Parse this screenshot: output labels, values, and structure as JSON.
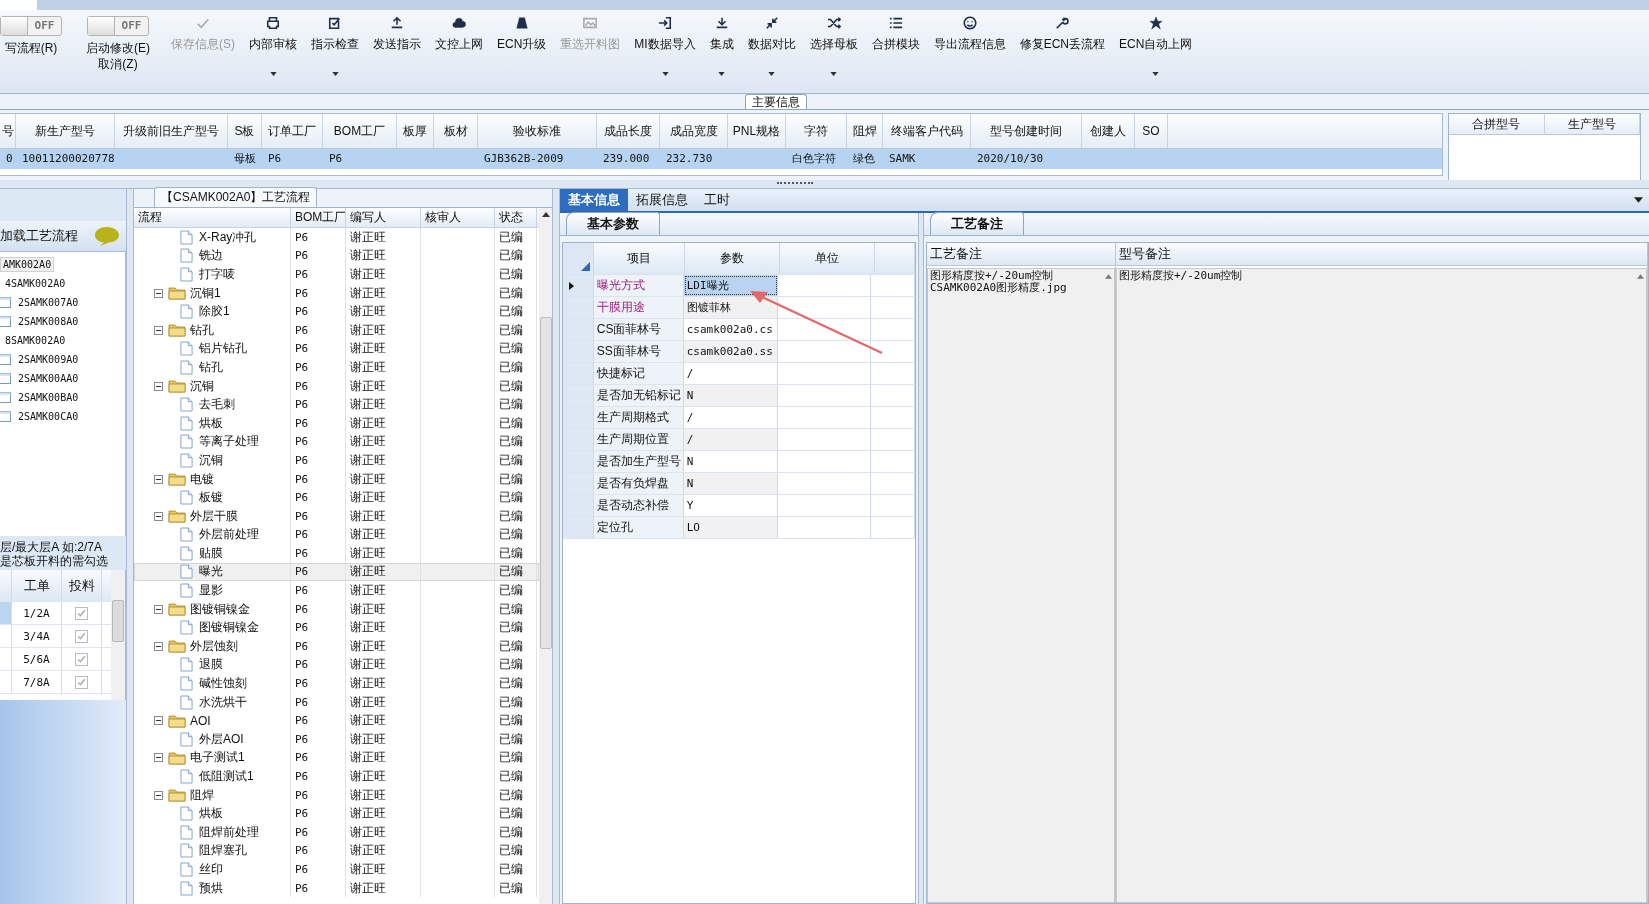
{
  "toolbar": {
    "toggles": [
      {
        "state_text": "OFF",
        "on": false,
        "labels": [
          "写流程(R)"
        ]
      },
      {
        "state_text": "OFF",
        "on": false,
        "labels": [
          "启动修改(E)",
          "取消(Z)"
        ]
      }
    ],
    "buttons": [
      {
        "label": "保存信息(S)",
        "disabled": true,
        "dropdown": false
      },
      {
        "label": "内部审核",
        "disabled": false,
        "dropdown": true
      },
      {
        "label": "指示检查",
        "disabled": false,
        "dropdown": true
      },
      {
        "label": "发送指示",
        "disabled": false,
        "dropdown": false
      },
      {
        "label": "文控上网",
        "disabled": false,
        "dropdown": false
      },
      {
        "label": "ECN升级",
        "disabled": false,
        "dropdown": false
      },
      {
        "label": "重选开料图",
        "disabled": true,
        "dropdown": false
      },
      {
        "label": "MI数据导入",
        "disabled": false,
        "dropdown": true
      },
      {
        "label": "集成",
        "disabled": false,
        "dropdown": true
      },
      {
        "label": "数据对比",
        "disabled": false,
        "dropdown": true
      },
      {
        "label": "选择母板",
        "disabled": false,
        "dropdown": true
      },
      {
        "label": "合拼模块",
        "disabled": false,
        "dropdown": false
      },
      {
        "label": "导出流程信息",
        "disabled": false,
        "dropdown": false
      },
      {
        "label": "修复ECN丢流程",
        "disabled": false,
        "dropdown": false
      },
      {
        "label": "ECN自动上网",
        "disabled": false,
        "dropdown": true
      }
    ]
  },
  "main_info": {
    "caption": "主要信息",
    "columns": [
      "号",
      "新生产型号",
      "升级前旧生产型号",
      "S板",
      "订单工厂",
      "BOM工厂",
      "板厚",
      "板材",
      "验收标准",
      "成品长度",
      "成品宽度",
      "PNL规格",
      "字符",
      "阻焊",
      "终端客户代码",
      "型号创建时间",
      "创建人",
      "SO"
    ],
    "rows": [
      {
        "selected": true,
        "cells": [
          "0",
          "10011200020778",
          null,
          "母板",
          "P6",
          "P6",
          null,
          null,
          "GJB362B-2009",
          "239.000",
          "232.730",
          null,
          "白色字符",
          "绿色",
          "SAMK",
          "2020/10/30",
          null,
          null
        ]
      }
    ]
  },
  "merge_table": {
    "columns": [
      "合拼型号",
      "生产型号"
    ]
  },
  "left_panel": {
    "header": "加载工艺流程",
    "items": [
      {
        "label": "AMK002A0",
        "selected": true,
        "children": [
          {
            "label": "4SAMK002A0",
            "selected": false,
            "children": [
              {
                "label": "2SAMK007A0",
                "selected": false
              },
              {
                "label": "2SAMK008A0",
                "selected": false
              }
            ]
          },
          {
            "label": "8SAMK002A0",
            "selected": false,
            "children": [
              {
                "label": "2SAMK009A0",
                "selected": false
              },
              {
                "label": "2SAMK00AA0",
                "selected": false
              },
              {
                "label": "2SAMK00BA0",
                "selected": false
              },
              {
                "label": "2SAMK00CA0",
                "selected": false
              }
            ]
          }
        ]
      }
    ],
    "notes": [
      "层/最大层A 如:2/7A",
      "是芯板开料的需勾选"
    ],
    "grid": {
      "columns": [
        "工单",
        "投料"
      ],
      "rows": [
        {
          "order": "1/2A",
          "checked": true,
          "disabled": true,
          "selected": true
        },
        {
          "order": "3/4A",
          "checked": true,
          "disabled": true,
          "selected": false
        },
        {
          "order": "5/6A",
          "checked": true,
          "disabled": true,
          "selected": false
        },
        {
          "order": "7/8A",
          "checked": true,
          "disabled": true,
          "selected": false
        }
      ]
    }
  },
  "process_tree": {
    "title": "【CSAMK002A0】工艺流程",
    "columns": [
      "流程",
      "BOM工厂",
      "编写人",
      "核审人",
      "状态"
    ],
    "rows": [
      {
        "kind": "step",
        "name": "X-Ray冲孔",
        "bom": "P6",
        "writer": "谢正旺",
        "status": "已编",
        "selected": false
      },
      {
        "kind": "step",
        "name": "铣边",
        "bom": "P6",
        "writer": "谢正旺",
        "status": "已编",
        "selected": false
      },
      {
        "kind": "step",
        "name": "打字唛",
        "bom": "P6",
        "writer": "谢正旺",
        "status": "已编",
        "selected": false
      },
      {
        "kind": "group",
        "name": "沉铜1",
        "bom": "P6",
        "writer": "谢正旺",
        "status": "已编",
        "selected": false,
        "expanded": true,
        "children": [
          {
            "kind": "step",
            "name": "除胶1",
            "bom": "P6",
            "writer": "谢正旺",
            "status": "已编",
            "selected": false
          }
        ]
      },
      {
        "kind": "group",
        "name": "钻孔",
        "bom": "P6",
        "writer": "谢正旺",
        "status": "已编",
        "selected": false,
        "expanded": true,
        "children": [
          {
            "kind": "step",
            "name": "铝片钻孔",
            "bom": "P6",
            "writer": "谢正旺",
            "status": "已编",
            "selected": false
          },
          {
            "kind": "step",
            "name": "钻孔",
            "bom": "P6",
            "writer": "谢正旺",
            "status": "已编",
            "selected": false
          }
        ]
      },
      {
        "kind": "group",
        "name": "沉铜",
        "bom": "P6",
        "writer": "谢正旺",
        "status": "已编",
        "selected": false,
        "expanded": true,
        "children": [
          {
            "kind": "step",
            "name": "去毛刺",
            "bom": "P6",
            "writer": "谢正旺",
            "status": "已编",
            "selected": false
          },
          {
            "kind": "step",
            "name": "烘板",
            "bom": "P6",
            "writer": "谢正旺",
            "status": "已编",
            "selected": false
          },
          {
            "kind": "step",
            "name": "等离子处理",
            "bom": "P6",
            "writer": "谢正旺",
            "status": "已编",
            "selected": false
          },
          {
            "kind": "step",
            "name": "沉铜",
            "bom": "P6",
            "writer": "谢正旺",
            "status": "已编",
            "selected": false
          }
        ]
      },
      {
        "kind": "group",
        "name": "电镀",
        "bom": "P6",
        "writer": "谢正旺",
        "status": "已编",
        "selected": false,
        "expanded": true,
        "children": [
          {
            "kind": "step",
            "name": "板镀",
            "bom": "P6",
            "writer": "谢正旺",
            "status": "已编",
            "selected": false
          }
        ]
      },
      {
        "kind": "group",
        "name": "外层干膜",
        "bom": "P6",
        "writer": "谢正旺",
        "status": "已编",
        "selected": false,
        "expanded": true,
        "children": [
          {
            "kind": "step",
            "name": "外层前处理",
            "bom": "P6",
            "writer": "谢正旺",
            "status": "已编",
            "selected": false
          },
          {
            "kind": "step",
            "name": "贴膜",
            "bom": "P6",
            "writer": "谢正旺",
            "status": "已编",
            "selected": false
          },
          {
            "kind": "step",
            "name": "曝光",
            "bom": "P6",
            "writer": "谢正旺",
            "status": "已编",
            "selected": true
          },
          {
            "kind": "step",
            "name": "显影",
            "bom": "P6",
            "writer": "谢正旺",
            "status": "已编",
            "selected": false
          }
        ]
      },
      {
        "kind": "group",
        "name": "图镀铜镍金",
        "bom": "P6",
        "writer": "谢正旺",
        "status": "已编",
        "selected": false,
        "expanded": true,
        "children": [
          {
            "kind": "step",
            "name": "图镀铜镍金",
            "bom": "P6",
            "writer": "谢正旺",
            "status": "已编",
            "selected": false
          }
        ]
      },
      {
        "kind": "group",
        "name": "外层蚀刻",
        "bom": "P6",
        "writer": "谢正旺",
        "status": "已编",
        "selected": false,
        "expanded": true,
        "children": [
          {
            "kind": "step",
            "name": "退膜",
            "bom": "P6",
            "writer": "谢正旺",
            "status": "已编",
            "selected": false
          },
          {
            "kind": "step",
            "name": "碱性蚀刻",
            "bom": "P6",
            "writer": "谢正旺",
            "status": "已编",
            "selected": false
          },
          {
            "kind": "step",
            "name": "水洗烘干",
            "bom": "P6",
            "writer": "谢正旺",
            "status": "已编",
            "selected": false
          }
        ]
      },
      {
        "kind": "group",
        "name": "AOI",
        "bom": "P6",
        "writer": "谢正旺",
        "status": "已编",
        "selected": false,
        "expanded": true,
        "children": [
          {
            "kind": "step",
            "name": "外层AOI",
            "bom": "P6",
            "writer": "谢正旺",
            "status": "已编",
            "selected": false
          }
        ]
      },
      {
        "kind": "group",
        "name": "电子测试1",
        "bom": "P6",
        "writer": "谢正旺",
        "status": "已编",
        "selected": false,
        "expanded": true,
        "children": [
          {
            "kind": "step",
            "name": "低阻测试1",
            "bom": "P6",
            "writer": "谢正旺",
            "status": "已编",
            "selected": false
          }
        ]
      },
      {
        "kind": "group",
        "name": "阻焊",
        "bom": "P6",
        "writer": "谢正旺",
        "status": "已编",
        "selected": false,
        "expanded": true,
        "children": [
          {
            "kind": "step",
            "name": "烘板",
            "bom": "P6",
            "writer": "谢正旺",
            "status": "已编",
            "selected": false
          },
          {
            "kind": "step",
            "name": "阻焊前处理",
            "bom": "P6",
            "writer": "谢正旺",
            "status": "已编",
            "selected": false
          },
          {
            "kind": "step",
            "name": "阻焊塞孔",
            "bom": "P6",
            "writer": "谢正旺",
            "status": "已编",
            "selected": false
          },
          {
            "kind": "step",
            "name": "丝印",
            "bom": "P6",
            "writer": "谢正旺",
            "status": "已编",
            "selected": false
          },
          {
            "kind": "step",
            "name": "预烘",
            "bom": "P6",
            "writer": "谢正旺",
            "status": "已编",
            "selected": false
          }
        ]
      }
    ]
  },
  "detail_tabs": [
    {
      "label": "基本信息",
      "selected": true
    },
    {
      "label": "拓展信息",
      "selected": false
    },
    {
      "label": "工时",
      "selected": false
    }
  ],
  "basic_params": {
    "tab": "基本参数",
    "columns": [
      "项目",
      "参数",
      "单位"
    ],
    "rows": [
      {
        "name": "曝光方式",
        "value": "LDI曝光",
        "required": true,
        "selected": true
      },
      {
        "name": "干膜用途",
        "value": "图镀菲林",
        "required": true,
        "selected": false
      },
      {
        "name": "CS面菲林号",
        "value": "csamk002a0.cs",
        "required": false,
        "selected": false
      },
      {
        "name": "SS面菲林号",
        "value": "csamk002a0.ss",
        "required": false,
        "selected": false
      },
      {
        "name": "快捷标记",
        "value": "/",
        "required": false,
        "selected": false
      },
      {
        "name": "是否加无铅标记",
        "value": "N",
        "required": false,
        "selected": false
      },
      {
        "name": "生产周期格式",
        "value": "/",
        "required": false,
        "selected": false
      },
      {
        "name": "生产周期位置",
        "value": "/",
        "required": false,
        "selected": false
      },
      {
        "name": "是否加生产型号",
        "value": "N",
        "required": false,
        "selected": false
      },
      {
        "name": "是否有负焊盘",
        "value": "N",
        "required": false,
        "selected": false
      },
      {
        "name": "是否动态补偿",
        "value": "Y",
        "required": false,
        "selected": false
      },
      {
        "name": "定位孔",
        "value": "LO",
        "required": false,
        "selected": false
      }
    ]
  },
  "process_notes": {
    "tab": "工艺备注",
    "columns": [
      {
        "title": "工艺备注",
        "lines": [
          "图形精度按+/-20um控制",
          "CSAMK002A0图形精度.jpg"
        ]
      },
      {
        "title": "型号备注",
        "lines": [
          "图形精度按+/-20um控制"
        ]
      }
    ]
  }
}
